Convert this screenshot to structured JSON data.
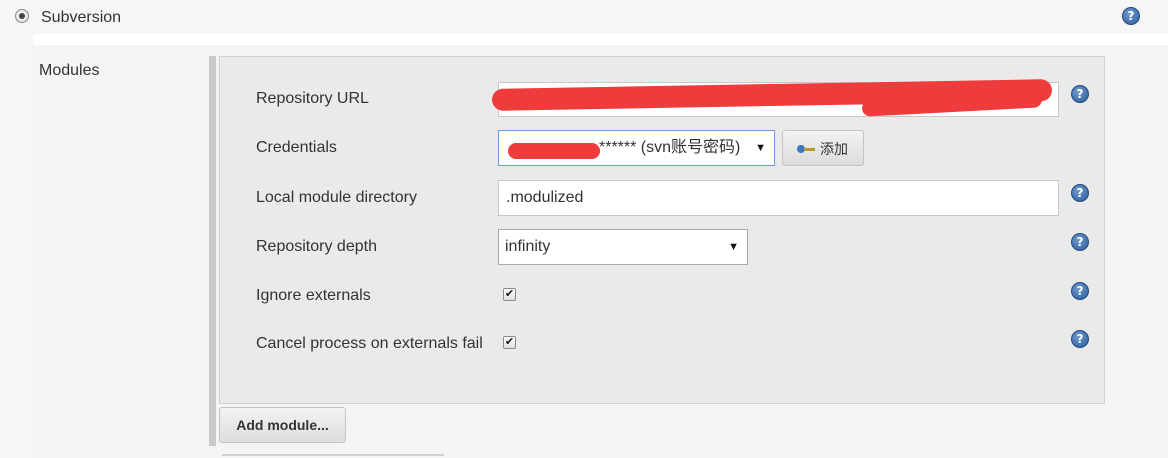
{
  "scm": {
    "label": "Subversion"
  },
  "modules": {
    "label": "Modules",
    "fields": {
      "repository_url": {
        "label": "Repository URL",
        "value": ""
      },
      "credentials": {
        "label": "Credentials",
        "selected": "****** (svn账号密码)",
        "add_label": "添加"
      },
      "local_module_directory": {
        "label": "Local module directory",
        "value": ".modulized"
      },
      "repository_depth": {
        "label": "Repository depth",
        "selected": "infinity"
      },
      "ignore_externals": {
        "label": "Ignore externals",
        "checked": true
      },
      "cancel_on_externals_fail": {
        "label": "Cancel process on externals fail",
        "checked": true
      }
    },
    "add_module_label": "Add module..."
  },
  "icons": {
    "check_glyph": "✔",
    "caret_glyph": "▼",
    "help": "help-icon",
    "key": "key-icon"
  },
  "colors": {
    "redaction": "#ee3b3b",
    "help_blue": "#2d5a96"
  }
}
